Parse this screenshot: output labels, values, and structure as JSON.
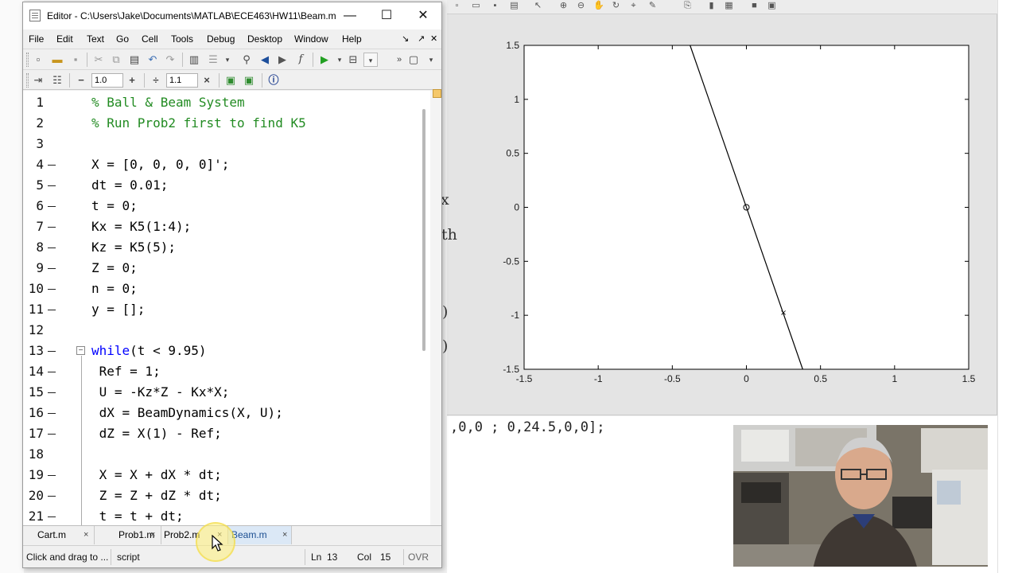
{
  "editor": {
    "title": "Editor - C:\\Users\\Jake\\Documents\\MATLAB\\ECE463\\HW11\\Beam.m",
    "window_buttons": {
      "minimize": "—",
      "maximize": "☐",
      "close": "✕"
    },
    "menu": [
      "File",
      "Edit",
      "Text",
      "Go",
      "Cell",
      "Tools",
      "Debug",
      "Desktop",
      "Window",
      "Help"
    ],
    "toolbar2": {
      "minus": "−",
      "value1": "1.0",
      "plus": "+",
      "divide": "÷",
      "value2": "1.1",
      "times": "×"
    },
    "gutter_numbers": [
      "1",
      "2",
      "3",
      "4",
      "5",
      "6",
      "7",
      "8",
      "9",
      "10",
      "11",
      "12",
      "13",
      "14",
      "15",
      "16",
      "17",
      "18",
      "19",
      "20",
      "21"
    ],
    "code_lines": [
      "% Ball & Beam System",
      "% Run Prob2 first to find K5",
      "",
      "X = [0, 0, 0, 0]';",
      "dt = 0.01;",
      "t = 0;",
      "Kx = K5(1:4);",
      "Kz = K5(5);",
      "Z = 0;",
      "n = 0;",
      "y = [];",
      "",
      "while",
      "(t < 9.95)",
      " Ref = 1;",
      " U = -Kz*Z - Kx*X;",
      " dX = BeamDynamics(X, U);",
      " dZ = X(1) - Ref;",
      "",
      " X = X + dX * dt;",
      " Z = Z + dZ * dt;",
      " t = t + dt;"
    ],
    "fold_glyph": "−",
    "tabs": [
      "Cart.m",
      "Prob1.m",
      "Prob2.m",
      "Beam.m"
    ],
    "tab_close": "×",
    "status": {
      "hint": "Click and drag to ...",
      "type": "script",
      "ln_label": "Ln",
      "ln": "13",
      "col_label": "Col",
      "col": "15",
      "ovr": "OVR"
    }
  },
  "figure": {
    "x_ticks": [
      "-1.5",
      "-1",
      "-0.5",
      "0",
      "0.5",
      "1",
      "1.5"
    ],
    "y_ticks": [
      "1.5",
      "1",
      "0.5",
      "0",
      "-0.5",
      "-1",
      "-1.5"
    ],
    "xlim": [
      -1.5,
      1.5
    ],
    "ylim": [
      -1.5,
      1.5
    ],
    "beam_line": {
      "x": [
        -0.38,
        0.38
      ],
      "y": [
        1.5,
        -1.5
      ]
    },
    "ball": {
      "x": 0.0,
      "y": 0.0
    },
    "cross": {
      "x": 0.25,
      "y": -0.97
    }
  },
  "command_window": {
    "visible_text": ",0,0 ; 0,24.5,0,0];",
    "fragments": [
      "x",
      "th",
      ")",
      ")"
    ]
  }
}
